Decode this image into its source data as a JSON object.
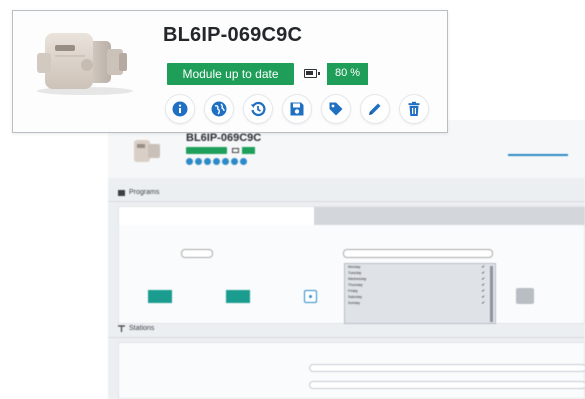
{
  "device": {
    "name": "BL6IP-069C9C",
    "status": "Module up to date",
    "battery": "80 %",
    "accent": "#1f9e5a",
    "icon_color": "#1f6fc2"
  },
  "actions": [
    {
      "name": "info-icon"
    },
    {
      "name": "globe-icon"
    },
    {
      "name": "history-icon"
    },
    {
      "name": "save-icon"
    },
    {
      "name": "tag-icon"
    },
    {
      "name": "pencil-icon"
    },
    {
      "name": "trash-icon"
    }
  ],
  "background": {
    "device_name": "BL6IP-069C9C",
    "programs_label": "Programs",
    "stations_label": "Stations",
    "days": [
      "Monday",
      "Tuesday",
      "Wednesday",
      "Thursday",
      "Friday",
      "Saturday",
      "Sunday"
    ]
  }
}
